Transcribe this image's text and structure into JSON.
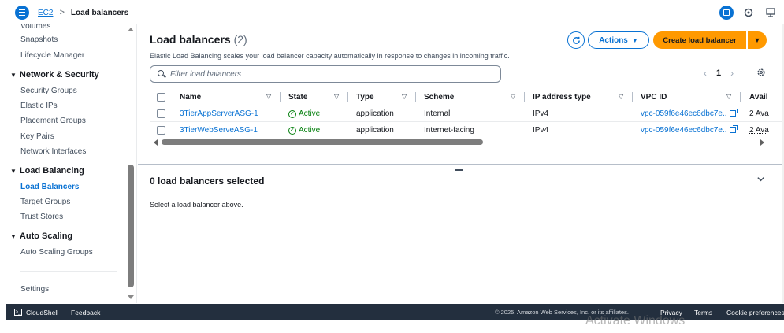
{
  "breadcrumb": {
    "root": "EC2",
    "separator": ">",
    "current": "Load balancers"
  },
  "sidebar": {
    "partial_top": "Volumes",
    "items_ebs": [
      "Snapshots",
      "Lifecycle Manager"
    ],
    "network_security": {
      "header": "Network & Security",
      "items": [
        "Security Groups",
        "Elastic IPs",
        "Placement Groups",
        "Key Pairs",
        "Network Interfaces"
      ]
    },
    "load_balancing": {
      "header": "Load Balancing",
      "items": [
        "Load Balancers",
        "Target Groups",
        "Trust Stores"
      ],
      "active": "Load Balancers"
    },
    "auto_scaling": {
      "header": "Auto Scaling",
      "items": [
        "Auto Scaling Groups"
      ]
    },
    "settings": "Settings"
  },
  "header": {
    "title": "Load balancers",
    "count": "(2)",
    "description": "Elastic Load Balancing scales your load balancer capacity automatically in response to changes in incoming traffic.",
    "actions_label": "Actions",
    "create_label": "Create load balancer"
  },
  "filter": {
    "placeholder": "Filter load balancers"
  },
  "pagination": {
    "current_page": "1"
  },
  "table": {
    "columns": [
      "Name",
      "State",
      "Type",
      "Scheme",
      "IP address type",
      "VPC ID",
      "Avail"
    ],
    "rows": [
      {
        "name": "3TierAppServerASG-1",
        "state": "Active",
        "type": "application",
        "scheme": "Internal",
        "ip_type": "IPv4",
        "vpc": "vpc-059f6e46ec6dbc7e..",
        "az": "2 Ava"
      },
      {
        "name": "3TierWebServeASG-1",
        "state": "Active",
        "type": "application",
        "scheme": "Internet-facing",
        "ip_type": "IPv4",
        "vpc": "vpc-059f6e46ec6dbc7e..",
        "az": "2 Ava"
      }
    ]
  },
  "selection": {
    "title": "0 load balancers selected",
    "message": "Select a load balancer above."
  },
  "footer": {
    "cloudshell": "CloudShell",
    "feedback": "Feedback",
    "copyright": "© 2025, Amazon Web Services, Inc. or its affiliates.",
    "privacy": "Privacy",
    "terms": "Terms",
    "cookies": "Cookie preferences"
  },
  "watermark": "Activate Windows",
  "colors": {
    "link": "#0972d3",
    "primary_button": "#ff9900",
    "success": "#037f0c",
    "footer_bg": "#232f3e"
  }
}
